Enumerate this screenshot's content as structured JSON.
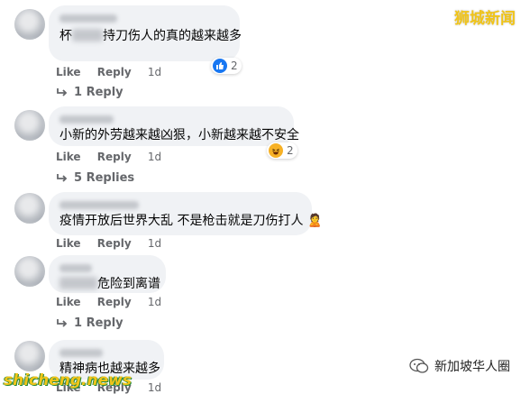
{
  "actions": {
    "like": "Like",
    "reply": "Reply"
  },
  "comments": [
    {
      "text_end": "持刀伤人的真的越来越多",
      "text_start": "杯",
      "time": "1d",
      "reaction_count": "2",
      "reaction_icon": "like-icon",
      "replies_label": "1 Reply"
    },
    {
      "text": "小新的外劳越来越凶狠，小新越来越不安全",
      "time": "1d",
      "reaction_count": "2",
      "reaction_icon": "haha-icon",
      "replies_label": "5 Replies"
    },
    {
      "text": "疫情开放后世界大乱 不是枪击就是刀伤打人",
      "emoji": "🙎",
      "time": "1d"
    },
    {
      "text_end": "危险到离谱",
      "time": "1d",
      "replies_label": "1 Reply"
    },
    {
      "text": "精神病也越来越多",
      "time": "1d"
    }
  ],
  "watermarks": {
    "top_right": "狮城新闻",
    "bottom_left": "shicheng.news",
    "bottom_right": "新加坡华人圈"
  },
  "colors": {
    "like_blue": "#1877f2",
    "bubble_bg": "#f0f2f5",
    "meta_gray": "#65676b",
    "watermark_yellow": "#f0c419"
  }
}
